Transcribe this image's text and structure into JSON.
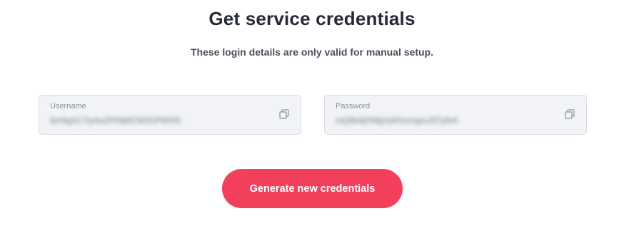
{
  "header": {
    "title": "Get service credentials",
    "subtitle": "These login details are only valid for manual setup."
  },
  "fields": {
    "username": {
      "label": "Username",
      "value": "8zHtgSCTiy4wZPKbkfCW3GPWXi5",
      "copy_icon": "copy-icon"
    },
    "password": {
      "label": "Password",
      "value": "mQ8b4jDNfgVpKhmnqexJ5Ty9vh",
      "copy_icon": "copy-icon"
    }
  },
  "actions": {
    "generate_label": "Generate new credentials",
    "accent_color": "#f2405c"
  }
}
